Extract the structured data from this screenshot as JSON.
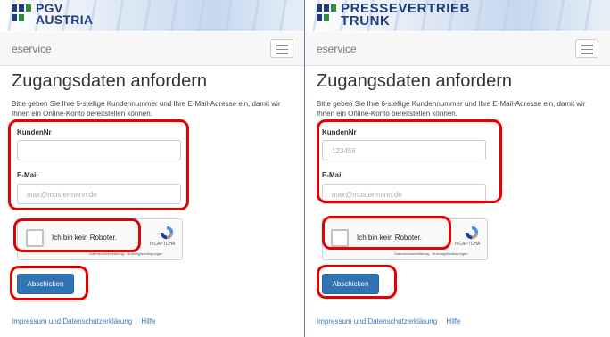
{
  "left": {
    "logo_line1": "PGV",
    "logo_line2": "AUSTRIA",
    "brand": "eservice",
    "heading": "Zugangsdaten anfordern",
    "description": "Bitte geben Sie Ihre 5-stellige Kundennummer und Ihre E-Mail-Adresse ein, damit wir Ihnen ein Online-Konto bereitstellen können.",
    "customer_label": "KundenNr",
    "customer_value": "",
    "email_label": "E-Mail",
    "email_placeholder": "max@mustermann.de",
    "recaptcha_label": "Ich bin kein Roboter.",
    "recaptcha_brand": "reCAPTCHA",
    "recaptcha_links": "Datenschutzerklärung - Nutzungsbedingungen",
    "submit": "Abschicken",
    "footer_imprint": "Impressum und Datenschutzerklärung",
    "footer_help": "Hilfe"
  },
  "right": {
    "logo_line1": "PRESSEVERTRIEB",
    "logo_line2": "TRUNK",
    "brand": "eservice",
    "heading": "Zugangsdaten anfordern",
    "description": "Bitte geben Sie Ihre 6-stellige Kundennummer und Ihre E-Mail-Adresse ein, damit wir Ihnen ein Online-Konto bereitstellen können.",
    "customer_label": "KundenNr",
    "customer_placeholder": "123456",
    "email_label": "E-Mail",
    "email_placeholder": "max@mustermann.de",
    "recaptcha_label": "Ich bin kein Roboter.",
    "recaptcha_brand": "reCAPTCHA",
    "recaptcha_links": "Datenschutzerklärung - Nutzungsbedingungen",
    "submit": "Abschicken",
    "footer_imprint": "Impressum und Datenschutzerklärung",
    "footer_help": "Hilfe"
  },
  "colors": {
    "highlight": "#e60000",
    "button": "#3174b4",
    "link": "#337ab7",
    "logo_blue": "#1f3d7a",
    "logo_green": "#2e8b3a"
  },
  "icons": [
    "hamburger-menu-icon",
    "recaptcha-logo-icon"
  ]
}
